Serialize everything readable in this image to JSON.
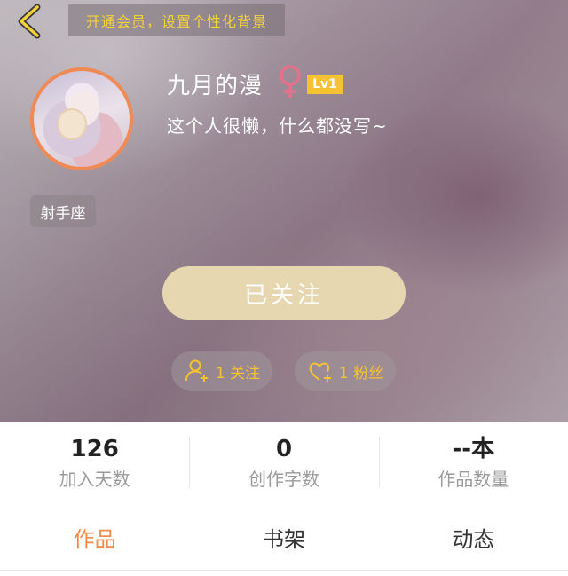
{
  "header": {
    "back_icon": "chevron-left-icon",
    "vip_banner": "开通会员，设置个性化背景"
  },
  "profile": {
    "username": "九月的漫",
    "gender_icon": "female-icon",
    "level": "Lv1",
    "bio": "这个人很懒，什么都没写~",
    "zodiac": "射手座"
  },
  "actions": {
    "follow_label": "已关注",
    "following_icon": "user-add-icon",
    "following_label": "1 关注",
    "fans_icon": "heart-add-icon",
    "fans_label": "1 粉丝"
  },
  "stats": [
    {
      "value": "126",
      "label": "加入天数"
    },
    {
      "value": "0",
      "label": "创作字数"
    },
    {
      "value": "--本",
      "label": "作品数量"
    }
  ],
  "tabs": [
    {
      "label": "作品",
      "active": true
    },
    {
      "label": "书架",
      "active": false
    },
    {
      "label": "动态",
      "active": false
    }
  ],
  "colors": {
    "accent_gold": "#f5c233",
    "accent_orange": "#f08a48",
    "female_pink": "#e8708a",
    "follow_button": "#e6d7b0"
  }
}
